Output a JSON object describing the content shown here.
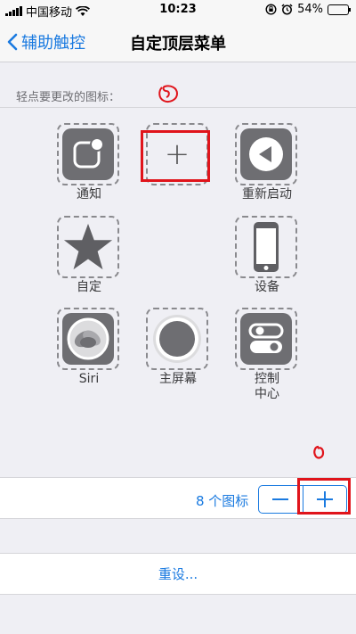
{
  "status_bar": {
    "carrier": "中国移动",
    "time": "10:23",
    "battery": "54%",
    "battery_level": 0.54,
    "icons": [
      "signal-icon",
      "wifi-icon",
      "orientation-lock-icon",
      "alarm-icon",
      "battery-icon"
    ]
  },
  "nav": {
    "back_label": "辅助触控",
    "title": "自定顶层菜单"
  },
  "hint": "轻点要更改的图标：",
  "grid": {
    "notification": "通知",
    "empty_slot": "+",
    "restart": "重新启动",
    "custom": "自定",
    "device": "设备",
    "siri": "Siri",
    "home": "主屏幕",
    "control_center_line1": "控制",
    "control_center_line2": "中心"
  },
  "counter": {
    "text": "8 个图标",
    "minus": "−",
    "plus": "+"
  },
  "reset_label": "重设...",
  "colors": {
    "accent": "#1a7ae0",
    "tile": "#6e6e72",
    "annotation": "#e0141b",
    "background": "#efeff4"
  }
}
